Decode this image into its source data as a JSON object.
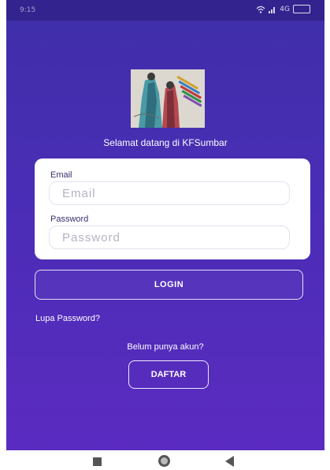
{
  "status_bar": {
    "time": "9:15",
    "network": "4G"
  },
  "welcome_text": "Selamat datang di KFSumbar",
  "login_form": {
    "email_label": "Email",
    "email_placeholder": "Email",
    "password_label": "Password",
    "password_placeholder": "Password"
  },
  "login_button": "LOGIN",
  "forgot_password": "Lupa Password?",
  "no_account": "Belum punya akun?",
  "register_button": "DAFTAR",
  "colors": {
    "background": "#4a2db6",
    "card": "#ffffff",
    "label": "#3a2f6e"
  },
  "icons": [
    "wifi-icon",
    "signal-icon",
    "battery-icon",
    "recent-apps-icon",
    "home-icon",
    "back-icon"
  ]
}
